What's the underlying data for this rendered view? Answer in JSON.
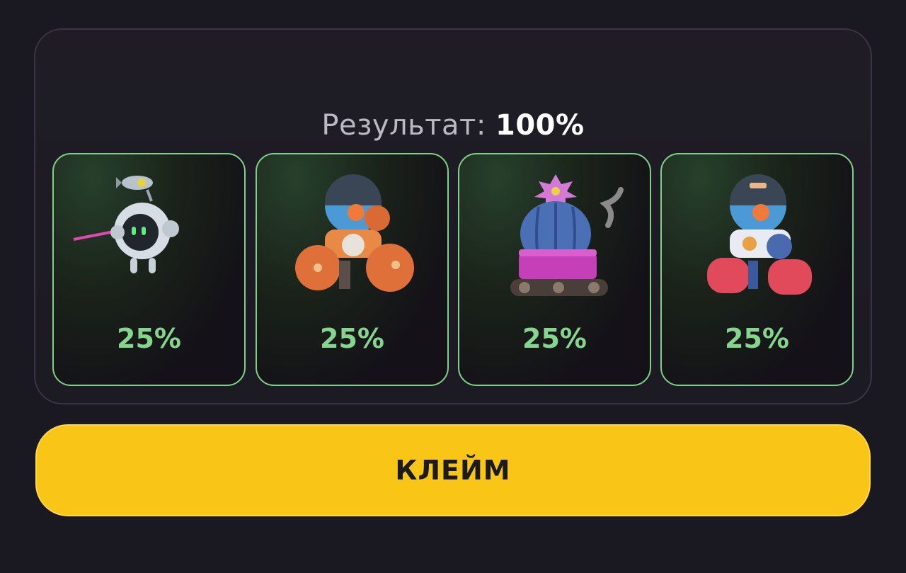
{
  "result": {
    "label": "Результат:",
    "value": "100%"
  },
  "cards": [
    {
      "icon": "drone-robot-icon",
      "percent": "25%"
    },
    {
      "icon": "orange-mech-robot-icon",
      "percent": "25%"
    },
    {
      "icon": "cactus-tank-robot-icon",
      "percent": "25%"
    },
    {
      "icon": "blue-mech-robot-icon",
      "percent": "25%"
    }
  ],
  "claim_button": {
    "label": "КЛЕЙМ"
  },
  "colors": {
    "accent_green": "#86d58e",
    "button_yellow": "#f9c517",
    "background": "#1a1820"
  }
}
